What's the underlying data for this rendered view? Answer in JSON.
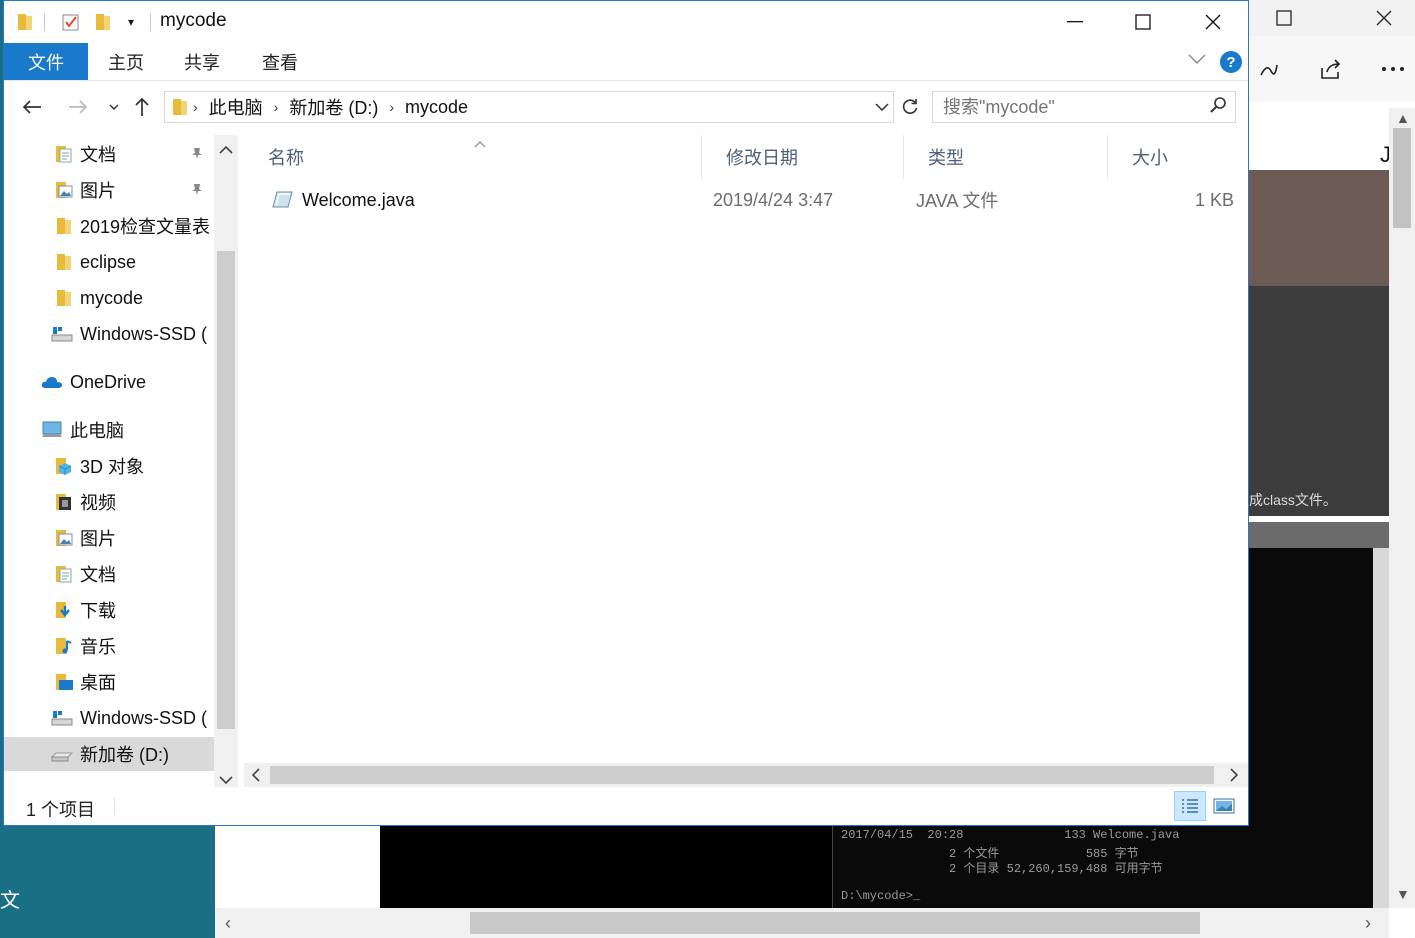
{
  "window": {
    "title": "mycode"
  },
  "ribbon": {
    "tabs": [
      "文件",
      "主页",
      "共享",
      "查看"
    ]
  },
  "address": {
    "breadcrumbs": [
      "此电脑",
      "新加卷 (D:)",
      "mycode"
    ],
    "search_placeholder": "搜索\"mycode\""
  },
  "nav": {
    "quick_access": [
      {
        "label": "文档",
        "icon": "document-icon",
        "pinned": true
      },
      {
        "label": "图片",
        "icon": "pictures-icon",
        "pinned": true
      },
      {
        "label": "2019检查文量表",
        "icon": "folder-icon",
        "pinned": false
      },
      {
        "label": "eclipse",
        "icon": "folder-icon",
        "pinned": false
      },
      {
        "label": "mycode",
        "icon": "folder-icon",
        "pinned": false
      },
      {
        "label": "Windows-SSD (",
        "icon": "drive-icon",
        "pinned": false
      }
    ],
    "onedrive": "OneDrive",
    "this_pc": "此电脑",
    "this_pc_items": [
      {
        "label": "3D 对象",
        "icon": "3d-objects-icon"
      },
      {
        "label": "视频",
        "icon": "videos-icon"
      },
      {
        "label": "图片",
        "icon": "pictures-icon"
      },
      {
        "label": "文档",
        "icon": "document-icon"
      },
      {
        "label": "下载",
        "icon": "downloads-icon"
      },
      {
        "label": "音乐",
        "icon": "music-icon"
      },
      {
        "label": "桌面",
        "icon": "desktop-icon"
      },
      {
        "label": "Windows-SSD (",
        "icon": "drive-icon"
      },
      {
        "label": "新加卷 (D:)",
        "icon": "drive-icon",
        "selected": true
      }
    ]
  },
  "columns": [
    "名称",
    "修改日期",
    "类型",
    "大小"
  ],
  "files": [
    {
      "name": "Welcome.java",
      "modified": "2019/4/24 3:47",
      "type": "JAVA 文件",
      "size": "1 KB"
    }
  ],
  "status": {
    "item_count": "1 个项目"
  },
  "background": {
    "desktop_text": "文",
    "right_edge_letter": "J",
    "caption_fragment": "成class文件。",
    "cmd_lines": [
      "2017/04/15  20:28              133 Welcome.java",
      "               2 个文件            585 字节",
      "               2 个目录 52,260,159,488 可用字节",
      "",
      "D:\\mycode>_"
    ]
  },
  "colors": {
    "accent": "#1979ca",
    "folder": "#e8b93a",
    "selection": "#d9d9d9"
  }
}
